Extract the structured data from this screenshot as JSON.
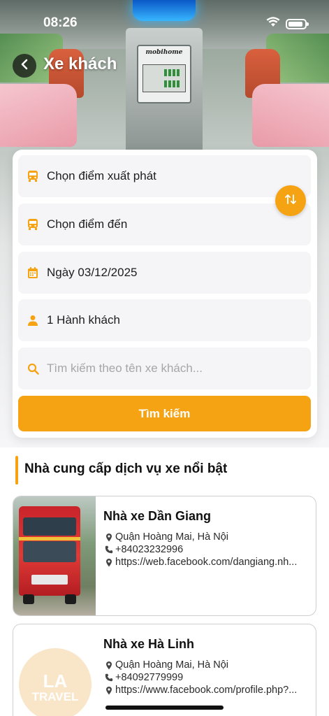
{
  "status_bar": {
    "time": "08:26"
  },
  "header": {
    "title": "Xe khách"
  },
  "hero_panel": {
    "brand": "mobihome"
  },
  "search_form": {
    "origin_placeholder": "Chọn điểm xuất phát",
    "destination_placeholder": "Chọn điểm đến",
    "date_value": "Ngày 03/12/2025",
    "passengers_value": "1 Hành khách",
    "search_placeholder": "Tìm kiếm theo tên xe khách...",
    "submit_label": "Tìm kiếm"
  },
  "providers_section": {
    "title": "Nhà cung cấp dịch vụ xe nổi bật",
    "items": [
      {
        "name": "Nhà xe Dần Giang",
        "address": "Quận Hoàng Mai, Hà Nội",
        "phone": "+84023232996",
        "url": "https://web.facebook.com/dangiang.nh..."
      },
      {
        "name": "Nhà xe Hà Linh",
        "address": "Quận Hoàng Mai, Hà Nội",
        "phone": "+84092779999",
        "url": "https://www.facebook.com/profile.php?...",
        "logo_line1": "LA",
        "logo_line2": "TRAVEL"
      }
    ]
  },
  "colors": {
    "accent": "#f6a313",
    "field_bg": "#f5f5f7",
    "placeholder": "#a6a6aa"
  },
  "icons": {
    "origin": "bus-icon",
    "destination": "bus-icon",
    "date": "calendar-icon",
    "passengers": "person-icon",
    "search": "search-icon",
    "swap": "swap-vertical-icon",
    "address": "location-pin-icon",
    "phone": "phone-icon",
    "url": "location-pin-icon"
  }
}
